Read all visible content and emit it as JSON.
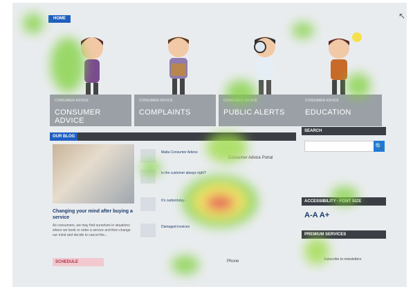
{
  "header": {
    "home_tag": "HOME"
  },
  "nav": {
    "items": [
      {
        "small": "CONSUMER ADVICE",
        "label": "CONSUMER ADVICE"
      },
      {
        "small": "CONSUMER ADVICE",
        "label": "COMPLAINTS"
      },
      {
        "small": "CONSUMER ADVICE",
        "label": "PUBLIC ALERTS"
      },
      {
        "small": "CONSUMER ADVICE",
        "label": "EDUCATION"
      }
    ]
  },
  "blog": {
    "section_label": "OUR BLOG",
    "headline": "Changing your mind after buying a service",
    "body": "As consumers, we may find ourselves in situations where we book or order a service and then change our mind and decide to cancel the...",
    "list": [
      {
        "title": "Malta Consumer Advice"
      },
      {
        "title": "Is the customer always right?"
      },
      {
        "title": "It's carbonbday..."
      },
      {
        "title": "Damaged invoices"
      }
    ]
  },
  "middle": {
    "portal_label": "Consumer Advice Portal",
    "phone_label": "Phone"
  },
  "sidebar": {
    "search_label": "SEARCH",
    "accessibility_label": "ACCESSIBILITY - FONT SIZE",
    "font_size_controls": "A-A A+",
    "premium_label": "PREMIUM SERVICES",
    "newsletter_label": "Subscribe to newsletters"
  },
  "footer": {
    "schedule_label": "SCHEDULE"
  },
  "colors": {
    "accent_blue": "#1f5fbf",
    "tile_grey": "#9aa0a6",
    "bar_dark": "#3b3f45"
  }
}
